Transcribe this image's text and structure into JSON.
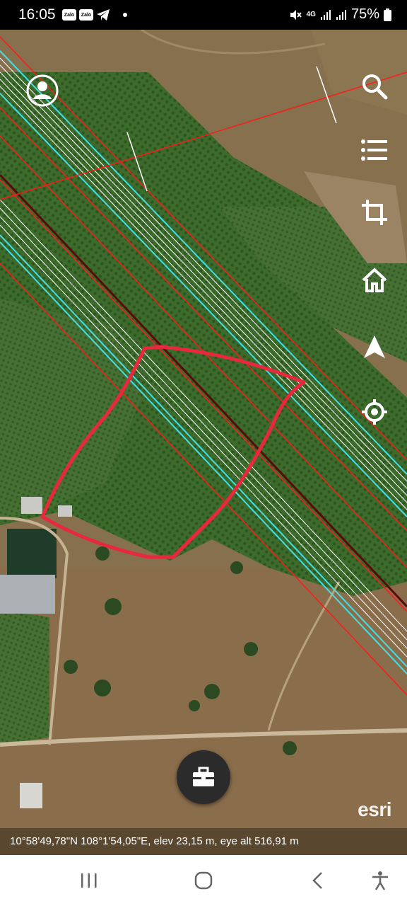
{
  "status_bar": {
    "time": "16:05",
    "notifications": [
      "Zalo",
      "Zalo",
      "telegram-icon",
      "dot"
    ],
    "signal_label": "4G",
    "battery": "75%"
  },
  "map": {
    "coordinates": "10°58'49,78\"N 108°1'54,05\"E, elev 23,15 m, eye alt 516,91 m",
    "attribution": "esri",
    "parcel_outline_color": "#e8283c",
    "line_colors": [
      "#ff1a1a",
      "#40e0e8",
      "#ffffff",
      "#5a0a0a"
    ]
  },
  "toolbar": {
    "items": [
      "search-icon",
      "layers-list-icon",
      "crop-icon",
      "home-icon",
      "navigation-arrow-icon",
      "my-location-icon"
    ]
  },
  "fab": {
    "icon": "briefcase-icon"
  },
  "navbar": {
    "items": [
      "recent-apps-icon",
      "home-button-icon",
      "back-icon",
      "accessibility-icon"
    ]
  }
}
